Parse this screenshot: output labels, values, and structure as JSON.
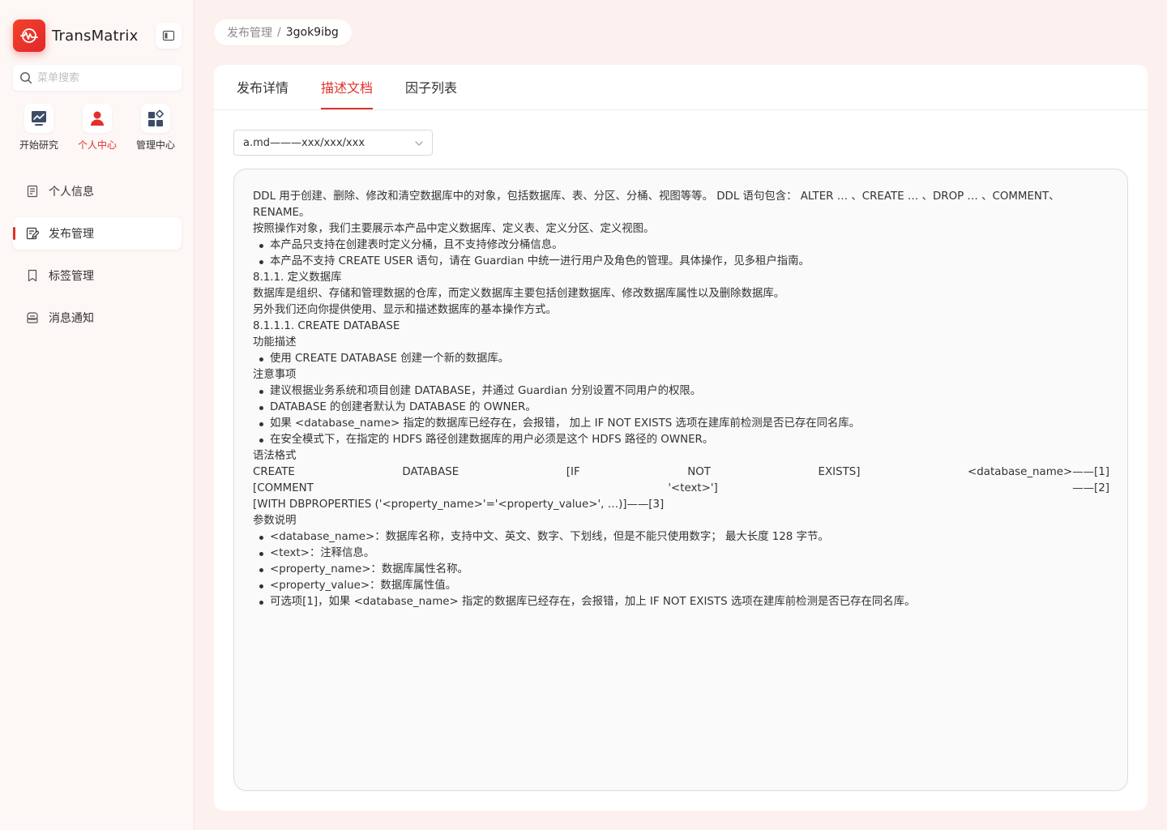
{
  "app": {
    "name": "TransMatrix"
  },
  "search": {
    "placeholder": "菜单搜索"
  },
  "quick_nav": [
    {
      "label": "开始研究",
      "icon": "chart-monitor-icon",
      "active": false
    },
    {
      "label": "个人中心",
      "icon": "user-icon",
      "active": true
    },
    {
      "label": "管理中心",
      "icon": "apps-grid-icon",
      "active": false
    }
  ],
  "menu": [
    {
      "label": "个人信息",
      "icon": "profile-doc-icon",
      "active": false
    },
    {
      "label": "发布管理",
      "icon": "publish-edit-icon",
      "active": true
    },
    {
      "label": "标签管理",
      "icon": "bookmark-icon",
      "active": false
    },
    {
      "label": "消息通知",
      "icon": "message-icon",
      "active": false
    }
  ],
  "breadcrumb": {
    "parent": "发布管理",
    "separator": "/",
    "current": "3gok9ibg"
  },
  "tabs": [
    {
      "label": "发布详情",
      "active": false
    },
    {
      "label": "描述文档",
      "active": true
    },
    {
      "label": "因子列表",
      "active": false
    }
  ],
  "file_select": {
    "value": "a.md———xxx/xxx/xxx"
  },
  "colors": {
    "accent": "#e0312d",
    "page_bg": "#fcf1ee",
    "sidebar_bg": "#fdf7f6"
  },
  "doc": {
    "intro": "DDL 用于创建、删除、修改和清空数据库中的对象，包括数据库、表、分区、分桶、视图等等。 DDL 语句包含： ALTER … 、CREATE … 、DROP … 、COMMENT、RENAME。",
    "scope": "按照操作对象，我们主要展示本产品中定义数据库、定义表、定义分区、定义视图。",
    "scope_bullets": [
      "本产品只支持在创建表时定义分桶，且不支持修改分桶信息。",
      "本产品不支持 CREATE USER 语句，请在 Guardian 中统一进行用户及角色的管理。具体操作，见多租户指南。"
    ],
    "section_1": "8.1.1. 定义数据库",
    "section_1_text_1": "数据库是组织、存储和管理数据的仓库，而定义数据库主要包括创建数据库、修改数据库属性以及删除数据库。",
    "section_1_text_2": "另外我们还向你提供使用、显示和描述数据库的基本操作方式。",
    "section_2": "8.1.1.1. CREATE DATABASE",
    "func_title": "功能描述",
    "func_bullets": [
      "使用 CREATE DATABASE 创建一个新的数据库。"
    ],
    "notes_title": "注意事项",
    "notes_bullets": [
      "建议根据业务系统和项目创建 DATABASE，并通过 Guardian 分别设置不同用户的权限。",
      "DATABASE 的创建者默认为 DATABASE 的 OWNER。",
      "如果 <database_name> 指定的数据库已经存在，会报错， 加上 IF NOT EXISTS 选项在建库前检测是否已存在同名库。",
      "在安全模式下，在指定的 HDFS 路径创建数据库的用户必须是这个 HDFS 路径的 OWNER。"
    ],
    "syntax_title": "语法格式",
    "syntax_line_1": "CREATE DATABASE [IF NOT EXISTS] <database_name>——[1]",
    "syntax_line_2": "[COMMENT '<text>'] ——[2]",
    "syntax_line_3": "[WITH DBPROPERTIES ('<property_name>'='<property_value>', …)]——[3]",
    "params_title": "参数说明",
    "params_bullets": [
      "<database_name>：数据库名称，支持中文、英文、数字、下划线，但是不能只使用数字； 最大长度 128 字节。",
      "<text>：注释信息。",
      "<property_name>：数据库属性名称。",
      "<property_value>：数据库属性值。",
      "可选项[1]，如果 <database_name> 指定的数据库已经存在，会报错，加上 IF NOT EXISTS 选项在建库前检测是否已存在同名库。"
    ]
  }
}
